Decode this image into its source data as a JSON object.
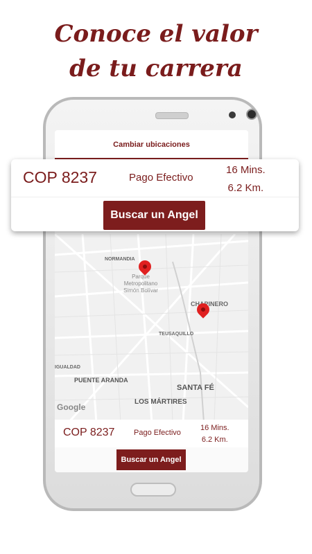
{
  "headline": {
    "line1": "Conoce el valor",
    "line2": "de tu carrera"
  },
  "app": {
    "topbar_title": "Cambiar ubicaciones",
    "map": {
      "labels": {
        "normandia": "NORMANDIA",
        "park": "Parque Metropolitano Simón Bolívar",
        "chapinero": "CHAPINERO",
        "teusaquillo": "TEUSAQUILLO",
        "iguaLdad": "IGUALDAD",
        "puente_aranda": "PUENTE ARANDA",
        "santa_fe": "SANTA FÉ",
        "martires": "LOS MÁRTIRES",
        "google": "Google"
      }
    },
    "fare": {
      "price": "COP 8237",
      "payment": "Pago Efectivo",
      "time": "16  Mins.",
      "distance": "6.2  Km."
    },
    "search_button": "Buscar un Angel"
  },
  "card": {
    "price": "COP 8237",
    "payment": "Pago Efectivo",
    "time": "16  Mins.",
    "distance": "6.2  Km.",
    "search_button": "Buscar un Angel"
  },
  "colors": {
    "brand": "#7d1d1d",
    "pin": "#e02020"
  }
}
